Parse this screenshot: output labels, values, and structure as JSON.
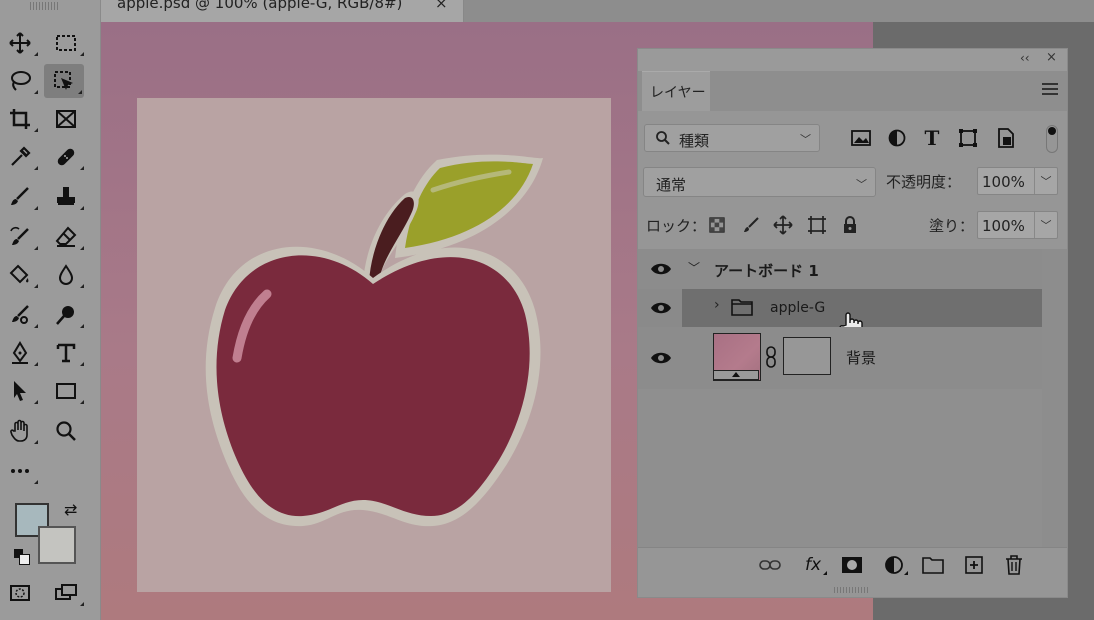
{
  "document": {
    "tab_title": "apple.psd @ 100% (apple-G, RGB/8#)",
    "close_glyph": "×"
  },
  "colors": {
    "foreground": "#a7b8bd",
    "background": "#c4c4c0",
    "apple_body": "#7a2a3d",
    "leaf": "#9aa02a",
    "stem": "#4a1d1f"
  },
  "toolbar": {
    "tools": [
      "move",
      "marquee",
      "lasso",
      "object-select",
      "crop",
      "frame",
      "eyedropper",
      "healing",
      "brush",
      "stamp",
      "history-brush",
      "eraser",
      "paint-bucket",
      "blur",
      "dodge",
      "burn",
      "pen",
      "type",
      "path-select",
      "rectangle",
      "hand",
      "zoom",
      "more"
    ]
  },
  "layers_panel": {
    "collapse_glyph": "‹‹",
    "close_glyph": "×",
    "tab_label": "レイヤー",
    "filter": {
      "label": "種類",
      "icons": [
        "image-filter-icon",
        "adjustment-filter-icon",
        "type-filter-icon",
        "shape-filter-icon",
        "smart-object-filter-icon"
      ]
    },
    "blend_mode": "通常",
    "opacity_label": "不透明度：",
    "opacity_value": "100%",
    "lock_label": "ロック：",
    "fill_label": "塗り：",
    "fill_value": "100%",
    "layers": [
      {
        "name": "アートボード 1",
        "kind": "artboard",
        "expanded": true,
        "visible": true
      },
      {
        "name": "apple-G",
        "kind": "group",
        "expanded": false,
        "visible": true,
        "selected": true
      },
      {
        "name": "背景",
        "kind": "pixel",
        "visible": true
      }
    ],
    "bottom_icons": [
      "link-layers-icon",
      "fx-icon",
      "layer-mask-icon",
      "adjustment-layer-icon",
      "new-group-icon",
      "new-layer-icon",
      "delete-layer-icon"
    ],
    "fx_label": "fx"
  }
}
